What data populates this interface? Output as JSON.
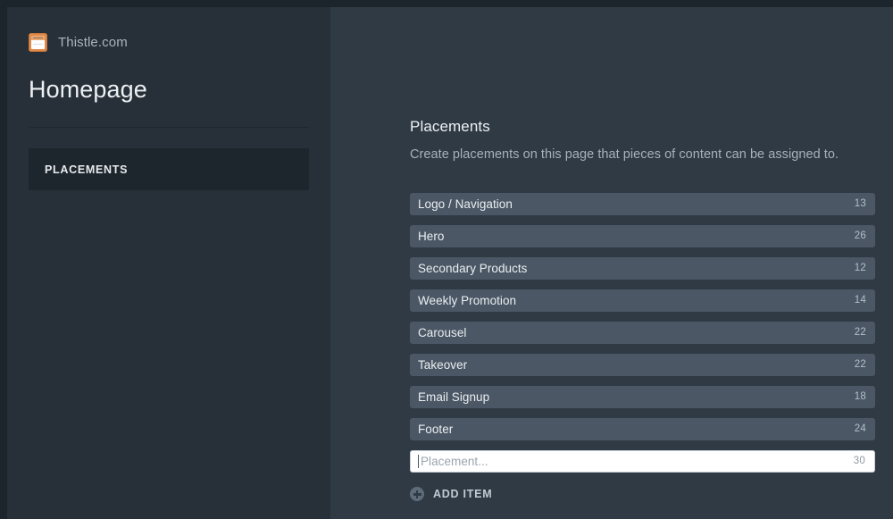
{
  "sidebar": {
    "brand": {
      "icon": "site-card-icon",
      "name": "Thistle.com",
      "icon_color": "#e08b49"
    },
    "page_title": "Homepage",
    "nav": {
      "items": [
        {
          "label": "PLACEMENTS",
          "active": true
        }
      ]
    }
  },
  "main": {
    "section_title": "Placements",
    "section_description": "Create placements on this page that pieces of content can be assigned to.",
    "placements": [
      {
        "label": "Logo / Navigation",
        "count": "13"
      },
      {
        "label": "Hero",
        "count": "26"
      },
      {
        "label": "Secondary Products",
        "count": "12"
      },
      {
        "label": "Weekly Promotion",
        "count": "14"
      },
      {
        "label": "Carousel",
        "count": "22"
      },
      {
        "label": "Takeover",
        "count": "22"
      },
      {
        "label": "Email Signup",
        "count": "18"
      },
      {
        "label": "Footer",
        "count": "24"
      }
    ],
    "new_placement": {
      "value": "",
      "placeholder": "Placement...",
      "count": "30"
    },
    "add_item": {
      "icon": "plus-circle-icon",
      "label": "ADD ITEM"
    }
  },
  "theme": {
    "window_border": "#1d252c",
    "sidebar_bg": "#272f38",
    "main_bg": "#303a45",
    "row_bg": "#4b5765",
    "nav_active_bg": "#1e262d"
  }
}
